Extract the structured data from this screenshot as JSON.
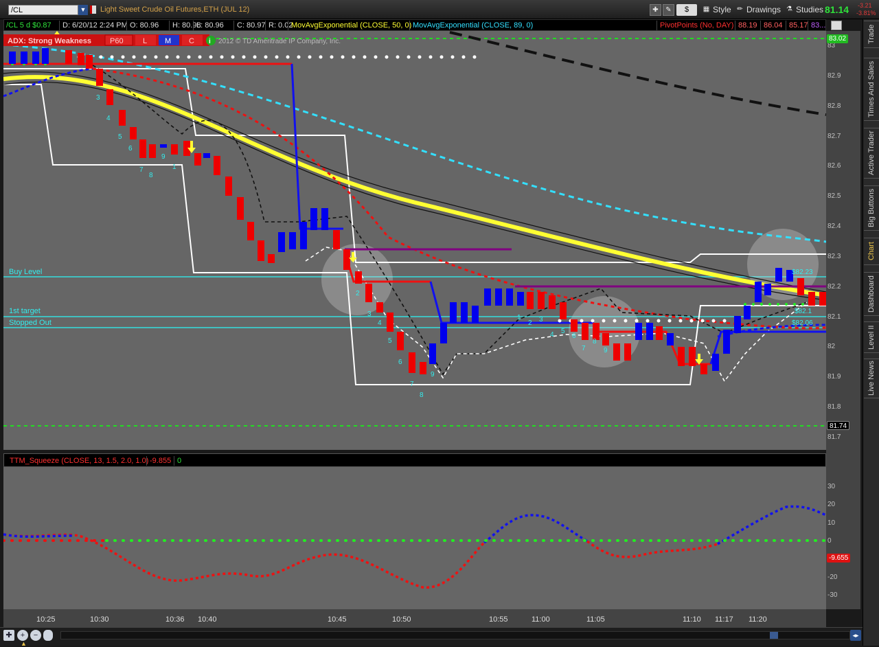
{
  "toolbar": {
    "symbol": "/CL",
    "description": "Light Sweet Crude Oil Futures,ETH (JUL 12)",
    "style_label": "Style",
    "drawings_label": "Drawings",
    "studies_label": "Studies",
    "dollar_label": "$",
    "last_price": "81.14",
    "change_abs": "-3.21",
    "change_pct": "-3.81%"
  },
  "status": {
    "period": "/CL 5 d $0.87",
    "date": "D: 6/20/12 2:24 PM",
    "open": "O: 80.96",
    "high": "H: 80.98",
    "low": "L: 80.96",
    "close": "C: 80.97",
    "range": "R: 0.02",
    "ma50": "MovAvgExponential (CLOSE, 50, 0)",
    "ma89": "MovAvgExponential (CLOSE, 89, 0)",
    "pivot_label": "PivotPoints (No, DAY)",
    "pivot_vals": [
      "88.19",
      "86.04",
      "85.17",
      "83..."
    ]
  },
  "adx_bar": {
    "label": "ADX: Strong Weakness",
    "p60": "P60",
    "l": "L",
    "m": "M",
    "c": "C",
    "copyright": "2012 © TD Ameritrade IP Company, Inc."
  },
  "levels": {
    "buy": "Buy Level",
    "first_target": "1st target",
    "stopped": "Stopped Out",
    "tag_8223": "$82.23",
    "tag_821": "$82.1",
    "tag_8206": "$82.06"
  },
  "price_axis": [
    "83",
    "82.9",
    "82.8",
    "82.7",
    "82.6",
    "82.5",
    "82.4",
    "82.3",
    "82.2",
    "82.1",
    "82",
    "81.9",
    "81.8",
    "81.7"
  ],
  "price_boxes": {
    "top": "83.02",
    "bottom": "81.74"
  },
  "squeeze": {
    "label": "TTM_Squeeze (CLOSE, 13, 1.5, 2.0, 1.0)",
    "value": "-9.855",
    "zero": "0",
    "axis": [
      "30",
      "20",
      "10",
      "0",
      "-10",
      "-20",
      "-30"
    ],
    "current": "-9.655"
  },
  "time_axis": [
    "10:25",
    "10:30",
    "10:36",
    "10:40",
    "10:45",
    "10:50",
    "10:55",
    "11:00",
    "11:05",
    "11:10",
    "11:17",
    "11:20"
  ],
  "rail_tabs": [
    "Trade",
    "Times And Sales",
    "Active Trader",
    "Big Buttons",
    "Chart",
    "Dashboard",
    "Level II",
    "Live News"
  ],
  "candle_counts": [
    "2",
    "3",
    "4",
    "5",
    "6",
    "7",
    "8",
    "9",
    "1",
    "2",
    "3",
    "4",
    "5",
    "6",
    "7",
    "8",
    "9",
    "1",
    "2",
    "3",
    "4",
    "5",
    "6",
    "7",
    "8",
    "9"
  ],
  "colors": {
    "up": "#0000ee",
    "down": "#ee0000",
    "ema50": "#ffff33",
    "ema89": "#33e0ff",
    "purple": "#800080"
  }
}
